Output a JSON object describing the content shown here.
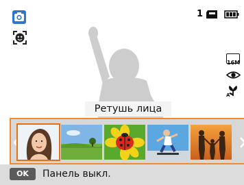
{
  "top_bar": {
    "mode_icon": "camera-mode-icon",
    "face_detect_icon": "face-detection-icon",
    "shot_count": "1",
    "card_icon": "memory-card-icon",
    "battery_icon": "battery-full-icon"
  },
  "right_indicators": {
    "resolution_icon": "resolution-16m-icon",
    "resolution_label": "16M",
    "eye_icon": "blink-detection-icon",
    "macro_icon": "auto-macro-icon"
  },
  "effect": {
    "label": "Ретушь лица"
  },
  "filmstrip": {
    "prev_icon": "chevron-left-icon",
    "next_icon": "chevron-right-icon",
    "selected_index": 0,
    "thumbnails": [
      "portrait",
      "landscape",
      "ladybug-flower",
      "skateboarder",
      "family-sunset"
    ]
  },
  "bottom_bar": {
    "key": "OK",
    "text": "Панель выкл."
  },
  "colors": {
    "accent": "#f08a2e",
    "mode_icon_bg": "#2f77c9",
    "panel_bg": "#dcdcdc",
    "key_bg": "#5b5b5b"
  }
}
